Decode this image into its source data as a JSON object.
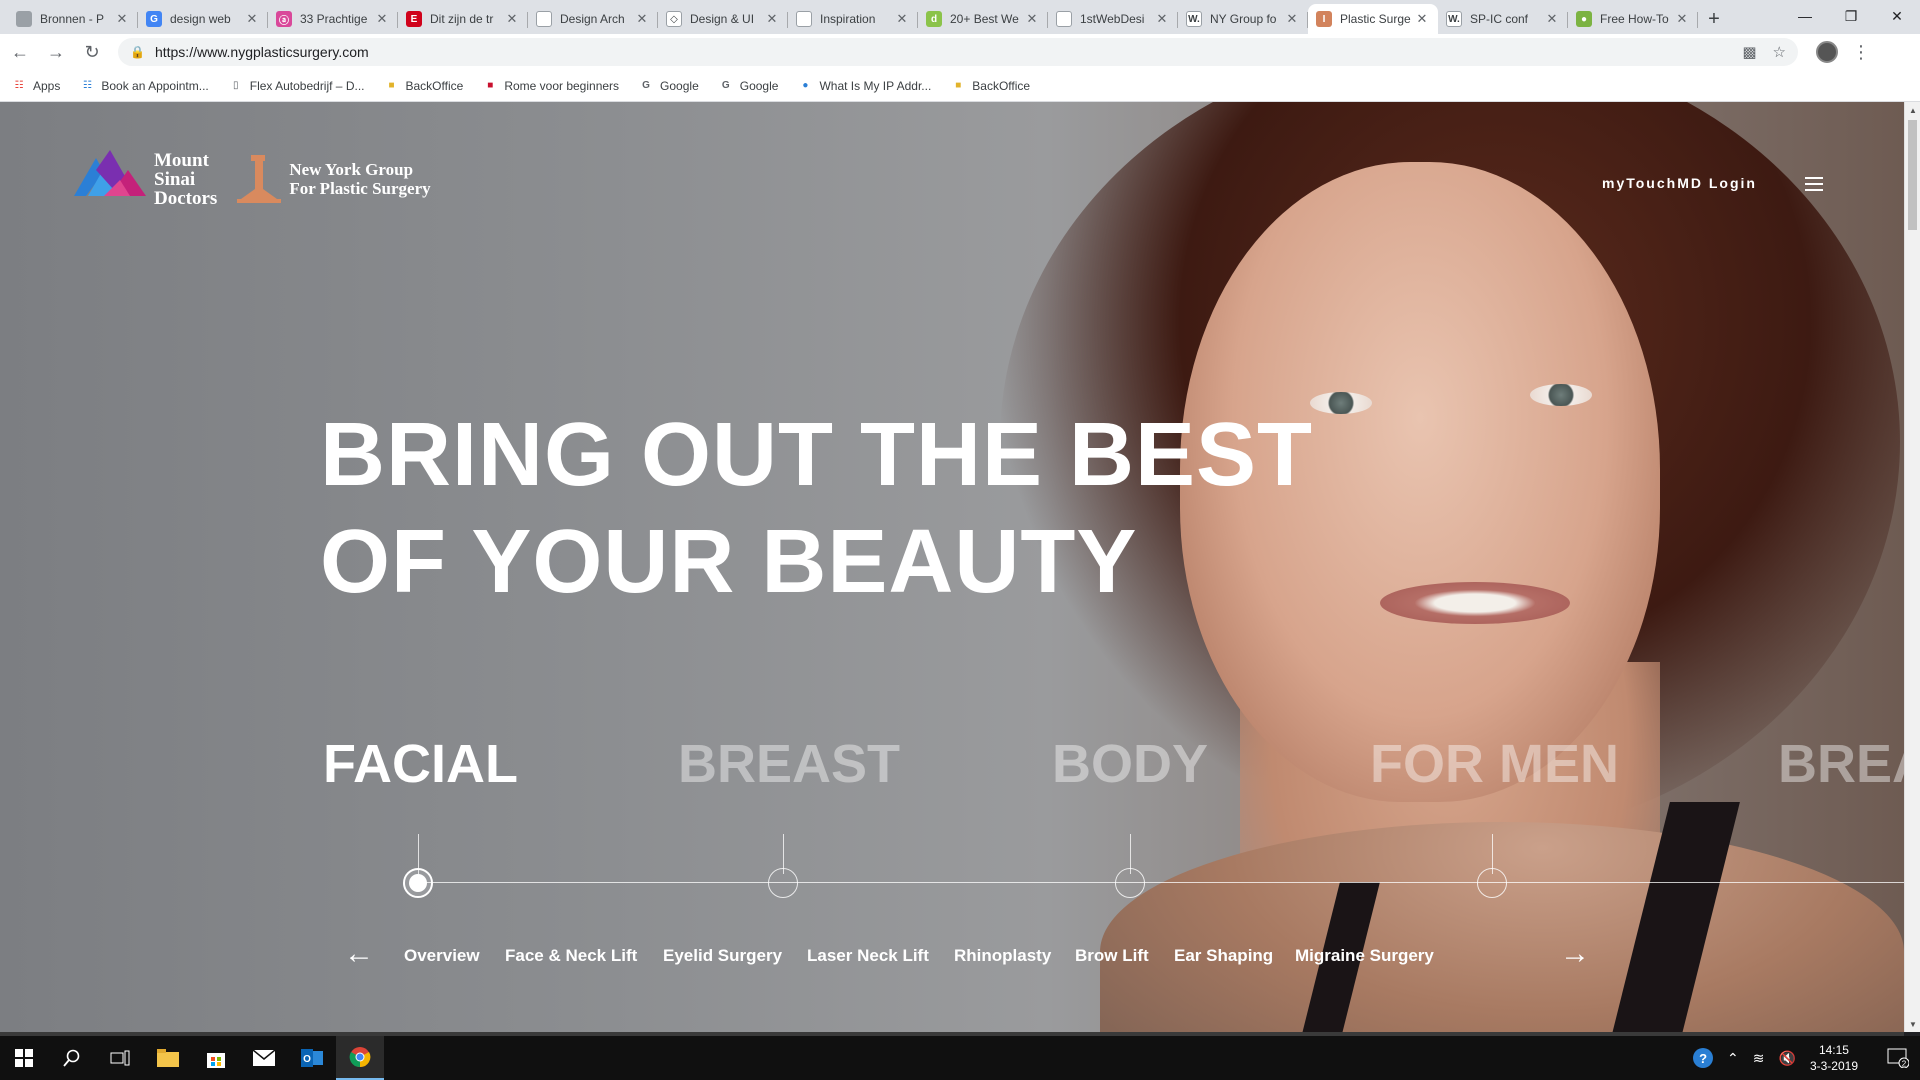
{
  "browser": {
    "tabs": [
      {
        "title": "Bronnen - P",
        "fav_color": "#9aa0a6",
        "fav_text": ""
      },
      {
        "title": "design web",
        "fav_color": "#4285f4",
        "fav_text": "G"
      },
      {
        "title": "33 Prachtige",
        "fav_color": "#d9489a",
        "fav_text": "ⓐ"
      },
      {
        "title": "Dit zijn de tr",
        "fav_color": "#d0021b",
        "fav_text": "E"
      },
      {
        "title": "Design Arch",
        "fav_color": "#ffffff",
        "fav_text": ""
      },
      {
        "title": "Design & UI",
        "fav_color": "#ffffff",
        "fav_text": "◇"
      },
      {
        "title": "Inspiration",
        "fav_color": "#ffffff",
        "fav_text": ""
      },
      {
        "title": "20+ Best We",
        "fav_color": "#8bc34a",
        "fav_text": "d"
      },
      {
        "title": "1stWebDesi",
        "fav_color": "#ffffff",
        "fav_text": ""
      },
      {
        "title": "NY Group fo",
        "fav_color": "#ffffff",
        "fav_text": "W."
      },
      {
        "title": "Plastic Surge",
        "fav_color": "#d2835c",
        "fav_text": "I",
        "active": true
      },
      {
        "title": "SP-IC conf",
        "fav_color": "#ffffff",
        "fav_text": "W."
      },
      {
        "title": "Free How-To",
        "fav_color": "#7cb342",
        "fav_text": "●"
      }
    ],
    "url": "https://www.nygplasticsurgery.com",
    "bookmarks": [
      {
        "label": "Apps",
        "icon": "apps-grid-icon"
      },
      {
        "label": "Book an Appointm...",
        "icon": "grid-icon"
      },
      {
        "label": "Flex Autobedrijf – D...",
        "icon": "page-icon"
      },
      {
        "label": "BackOffice",
        "icon": "folder-icon"
      },
      {
        "label": "Rome voor beginners",
        "icon": "flag-icon"
      },
      {
        "label": "Google",
        "icon": "google-icon"
      },
      {
        "label": "Google",
        "icon": "google-icon"
      },
      {
        "label": "What Is My IP Addr...",
        "icon": "globe-icon"
      },
      {
        "label": "BackOffice",
        "icon": "folder-icon"
      }
    ]
  },
  "site": {
    "logo_ms": [
      "Mount",
      "Sinai",
      "Doctors"
    ],
    "logo_nyg": [
      "New York Group",
      "For Plastic Surgery"
    ],
    "login": "myTouchMD Login",
    "headline": [
      "BRING OUT THE BEST",
      "OF YOUR BEAUTY"
    ],
    "categories": [
      "FACIAL",
      "BREAST",
      "BODY",
      "FOR MEN",
      "BREA"
    ],
    "active_category": 0,
    "subnav": [
      "Overview",
      "Face & Neck Lift",
      "Eyelid Surgery",
      "Laser Neck Lift",
      "Rhinoplasty",
      "Brow Lift",
      "Ear Shaping",
      "Migraine Surgery"
    ]
  },
  "colors": {
    "ms_logo": [
      "#2b7fd6",
      "#7a2fb0",
      "#c4217a"
    ],
    "nyg_logo": "#d98a5e",
    "chrome_bar": "#dee1e6",
    "taskbar": "#101010"
  },
  "taskbar": {
    "time": "14:15",
    "date": "3-3-2019",
    "notifications": "2"
  }
}
